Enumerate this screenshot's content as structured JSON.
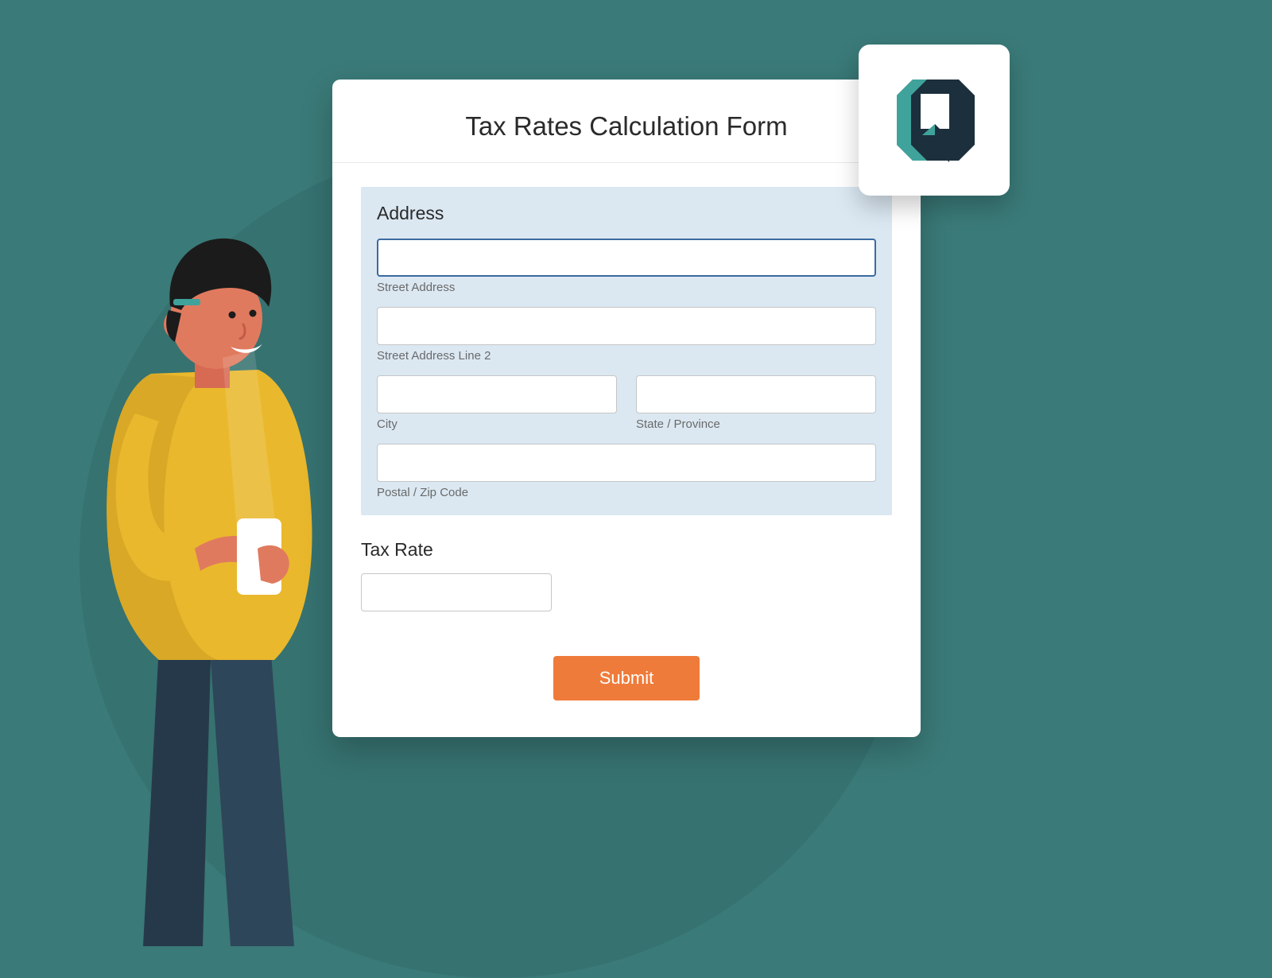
{
  "form": {
    "title": "Tax Rates Calculation Form",
    "address": {
      "heading": "Address",
      "street_label": "Street Address",
      "street_value": "",
      "street2_label": "Street Address Line 2",
      "street2_value": "",
      "city_label": "City",
      "city_value": "",
      "state_label": "State / Province",
      "state_value": "",
      "postal_label": "Postal / Zip Code",
      "postal_value": ""
    },
    "taxrate": {
      "heading": "Tax Rate",
      "value": ""
    },
    "submit_label": "Submit"
  },
  "colors": {
    "background": "#3a7a78",
    "accent": "#ef7b3a",
    "address_block": "#dbe8f2",
    "logo_dark": "#1c2f3d",
    "logo_teal": "#3fa39c"
  }
}
